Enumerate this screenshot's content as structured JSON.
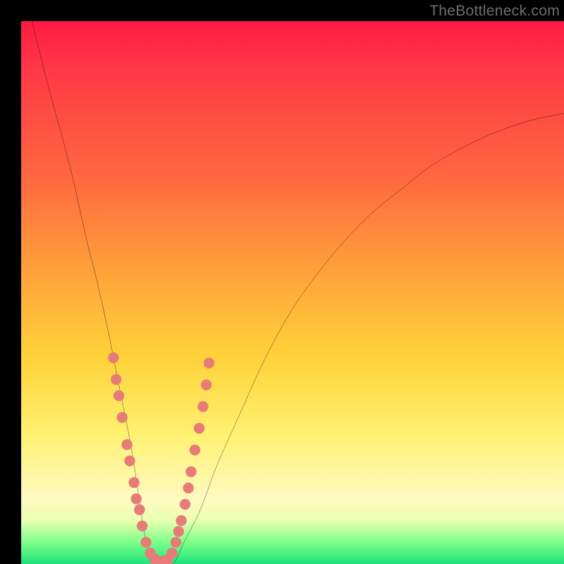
{
  "watermark": {
    "text": "TheBottleneck.com"
  },
  "colors": {
    "background": "#000000",
    "curve": "#000000",
    "marker": "#e77b78",
    "gradient_stops": [
      "#ff1a44",
      "#ff3646",
      "#ff6b3f",
      "#ffa83a",
      "#ffd23a",
      "#fff170",
      "#fffac0",
      "#e9ffb0",
      "#7dff8a",
      "#1fe27a"
    ]
  },
  "chart_data": {
    "type": "line",
    "title": "",
    "xlabel": "",
    "ylabel": "",
    "xlim": [
      0,
      100
    ],
    "ylim": [
      0,
      100
    ],
    "grid": false,
    "legend": null,
    "series": [
      {
        "name": "bottleneck-curve",
        "x": [
          2,
          5,
          8,
          10,
          12,
          14,
          16,
          18,
          19,
          20,
          21,
          22,
          23,
          24,
          26,
          28,
          30,
          33,
          36,
          40,
          45,
          50,
          55,
          60,
          65,
          70,
          75,
          80,
          85,
          90,
          95,
          100
        ],
        "y": [
          100,
          88,
          77,
          69,
          60,
          52,
          43,
          33,
          28,
          23,
          17,
          10,
          4,
          1,
          0,
          0,
          4,
          10,
          18,
          27,
          38,
          47,
          54,
          60,
          65,
          69,
          73,
          76,
          78.5,
          80.5,
          82,
          83
        ]
      }
    ],
    "markers": {
      "name": "highlight-dots",
      "note": "pink dots clustered near the curve minimum on both branches",
      "points": [
        {
          "x": 17.0,
          "y": 38
        },
        {
          "x": 17.5,
          "y": 34
        },
        {
          "x": 18.0,
          "y": 31
        },
        {
          "x": 18.6,
          "y": 27
        },
        {
          "x": 19.5,
          "y": 22
        },
        {
          "x": 20.0,
          "y": 19
        },
        {
          "x": 20.8,
          "y": 15
        },
        {
          "x": 21.2,
          "y": 12
        },
        {
          "x": 21.8,
          "y": 10
        },
        {
          "x": 22.3,
          "y": 7
        },
        {
          "x": 23.0,
          "y": 4
        },
        {
          "x": 23.8,
          "y": 2
        },
        {
          "x": 24.5,
          "y": 1
        },
        {
          "x": 25.3,
          "y": 0.5
        },
        {
          "x": 26.2,
          "y": 0.5
        },
        {
          "x": 27.0,
          "y": 0.8
        },
        {
          "x": 27.8,
          "y": 2
        },
        {
          "x": 28.5,
          "y": 4
        },
        {
          "x": 29.0,
          "y": 6
        },
        {
          "x": 29.5,
          "y": 8
        },
        {
          "x": 30.2,
          "y": 11
        },
        {
          "x": 30.8,
          "y": 14
        },
        {
          "x": 31.3,
          "y": 17
        },
        {
          "x": 32.0,
          "y": 21
        },
        {
          "x": 32.8,
          "y": 25
        },
        {
          "x": 33.5,
          "y": 29
        },
        {
          "x": 34.1,
          "y": 33
        },
        {
          "x": 34.6,
          "y": 37
        }
      ]
    }
  }
}
